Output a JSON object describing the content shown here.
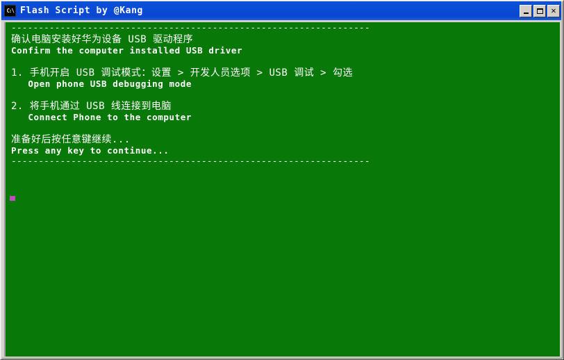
{
  "window": {
    "title": "Flash Script by @Kang",
    "icon_label": "C:\\",
    "icon_name": "console-icon",
    "buttons": {
      "minimize": "_",
      "maximize": "□",
      "close": "✕"
    },
    "background_color": "#087808",
    "titlebar_color": "#0a4ad4",
    "text_color": "#ffffff",
    "cursor_color": "#bd4fbd"
  },
  "console": {
    "lines": [
      {
        "type": "rule",
        "text": "------------------------------------------------------------------"
      },
      {
        "type": "cn",
        "text": "确认电脑安装好华为设备 USB 驱动程序"
      },
      {
        "type": "en",
        "text": "Confirm the computer installed USB driver"
      },
      {
        "type": "blank",
        "text": ""
      },
      {
        "type": "cn",
        "text": "1. 手机开启 USB 调试模式：设置 > 开发人员选项 > USB 调试 > 勾选"
      },
      {
        "type": "en",
        "text": "   Open phone USB debugging mode"
      },
      {
        "type": "blank",
        "text": ""
      },
      {
        "type": "cn",
        "text": "2. 将手机通过 USB 线连接到电脑"
      },
      {
        "type": "en",
        "text": "   Connect Phone to the computer"
      },
      {
        "type": "blank",
        "text": ""
      },
      {
        "type": "cn",
        "text": "准备好后按任意键继续..."
      },
      {
        "type": "en",
        "text": "Press any key to continue..."
      },
      {
        "type": "rule",
        "text": "------------------------------------------------------------------"
      }
    ]
  }
}
